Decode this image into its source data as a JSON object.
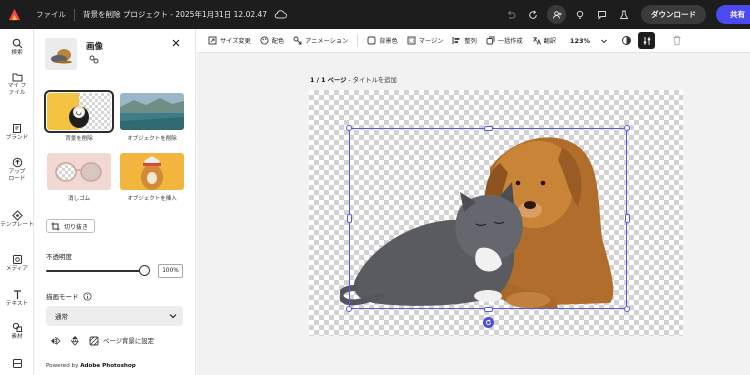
{
  "titlebar": {
    "file_menu": "ファイル",
    "document_title": "背景を削除 プロジェクト - 2025年1月31日 12.02.47",
    "download_label": "ダウンロード",
    "share_label": "共有"
  },
  "rail": {
    "items": [
      {
        "label": "検索",
        "icon": "search-icon"
      },
      {
        "label": "マイ ファイル",
        "icon": "folder-icon"
      },
      {
        "label": "ブランド",
        "icon": "brand-icon"
      },
      {
        "label": "アップ ロード",
        "icon": "upload-icon"
      },
      {
        "label": "テンプレート",
        "icon": "template-icon"
      },
      {
        "label": "メディア",
        "icon": "media-icon"
      },
      {
        "label": "テキスト",
        "icon": "text-icon"
      },
      {
        "label": "素材",
        "icon": "elements-icon"
      }
    ]
  },
  "panel": {
    "title": "画像",
    "actions": [
      {
        "label": "背景を削除"
      },
      {
        "label": "オブジェクトを削除"
      },
      {
        "label": "消しゴム"
      },
      {
        "label": "オブジェクトを挿入"
      }
    ],
    "crop_label": "切り抜き",
    "opacity_label": "不透明度",
    "opacity_value": "100%",
    "opacity_level": 1.0,
    "blend_label": "描画モード",
    "blend_value": "通常",
    "page_bg_label": "ページ背景に設定",
    "powered_prefix": "Powered by ",
    "powered_brand": "Adobe Photoshop"
  },
  "toolbar": {
    "items": [
      {
        "label": "サイズ変更",
        "icon": "resize-icon"
      },
      {
        "label": "配色",
        "icon": "palette-icon"
      },
      {
        "label": "アニメーション",
        "icon": "animation-icon"
      },
      {
        "label": "背景色",
        "icon": "background-color-icon"
      },
      {
        "label": "マージン",
        "icon": "margin-icon"
      },
      {
        "label": "整列",
        "icon": "align-icon"
      },
      {
        "label": "一括作成",
        "icon": "bulk-create-icon"
      },
      {
        "label": "翻訳",
        "icon": "translate-icon"
      }
    ],
    "zoom": "123%"
  },
  "canvas": {
    "page_number": "1 / 1 ページ",
    "page_title_placeholder": " - タイトルを追加"
  },
  "colors": {
    "accent": "#4a4af0",
    "selection": "#5a5ae0",
    "titlebar_bg": "#1d1d1d",
    "canvas_bg": "#f2f2f2"
  }
}
